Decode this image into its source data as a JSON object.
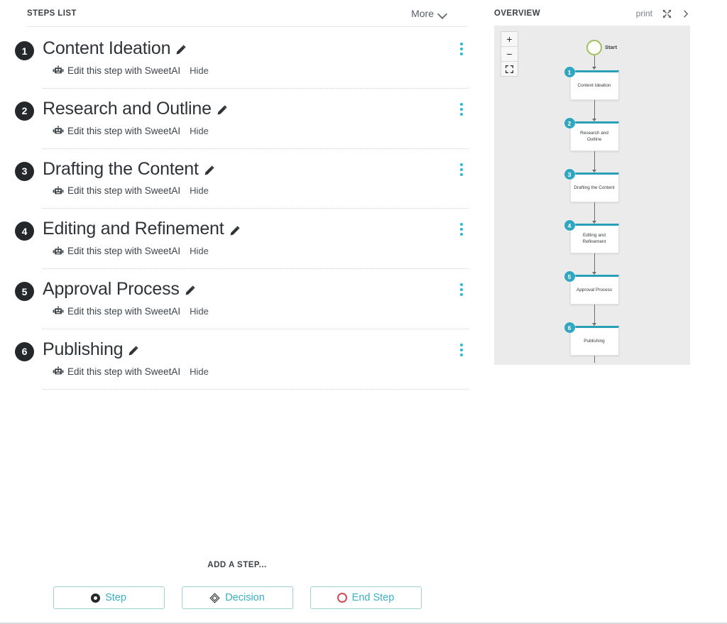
{
  "steps_panel": {
    "title": "STEPS LIST",
    "more_label": "More",
    "more_icon": "chevron-down-icon",
    "steps": [
      {
        "number": "1",
        "title": "Content Ideation",
        "ai_text": "Edit this step with SweetAI",
        "hide_label": "Hide"
      },
      {
        "number": "2",
        "title": "Research and Outline",
        "ai_text": "Edit this step with SweetAI",
        "hide_label": "Hide"
      },
      {
        "number": "3",
        "title": "Drafting the Content",
        "ai_text": "Edit this step with SweetAI",
        "hide_label": "Hide"
      },
      {
        "number": "4",
        "title": "Editing and Refinement",
        "ai_text": "Edit this step with SweetAI",
        "hide_label": "Hide"
      },
      {
        "number": "5",
        "title": "Approval Process",
        "ai_text": "Edit this step with SweetAI",
        "hide_label": "Hide"
      },
      {
        "number": "6",
        "title": "Publishing",
        "ai_text": "Edit this step with SweetAI",
        "hide_label": "Hide"
      }
    ],
    "add_section": {
      "label": "ADD A STEP...",
      "buttons": [
        {
          "label": "Step",
          "icon": "filled-circle-icon"
        },
        {
          "label": "Decision",
          "icon": "diamond-icon"
        },
        {
          "label": "End Step",
          "icon": "red-circle-outline-icon"
        }
      ]
    }
  },
  "overview_panel": {
    "title": "OVERVIEW",
    "print_label": "print",
    "expand_icon": "shuffle-expand-icon",
    "next_icon": "chevron-right-icon",
    "zoom_controls": [
      {
        "icon": "plus-icon",
        "label": "+"
      },
      {
        "icon": "minus-icon",
        "label": "−"
      },
      {
        "icon": "fullscreen-icon",
        "label": ""
      }
    ],
    "diagram": {
      "start_label": "Start",
      "nodes": [
        {
          "number": "1",
          "label": "Content Ideation"
        },
        {
          "number": "2",
          "label": "Research and Outline"
        },
        {
          "number": "3",
          "label": "Drafting the Content"
        },
        {
          "number": "4",
          "label": "Editing and Refinement"
        },
        {
          "number": "5",
          "label": "Approval Process"
        },
        {
          "number": "6",
          "label": "Publishing"
        }
      ]
    }
  },
  "colors": {
    "accent_teal": "#30a6c0",
    "badge_dark": "#25282b",
    "start_green": "#a4bf62",
    "end_red": "#d24a52",
    "canvas_bg": "#ebebeb",
    "link_teal": "#39b0c4"
  }
}
